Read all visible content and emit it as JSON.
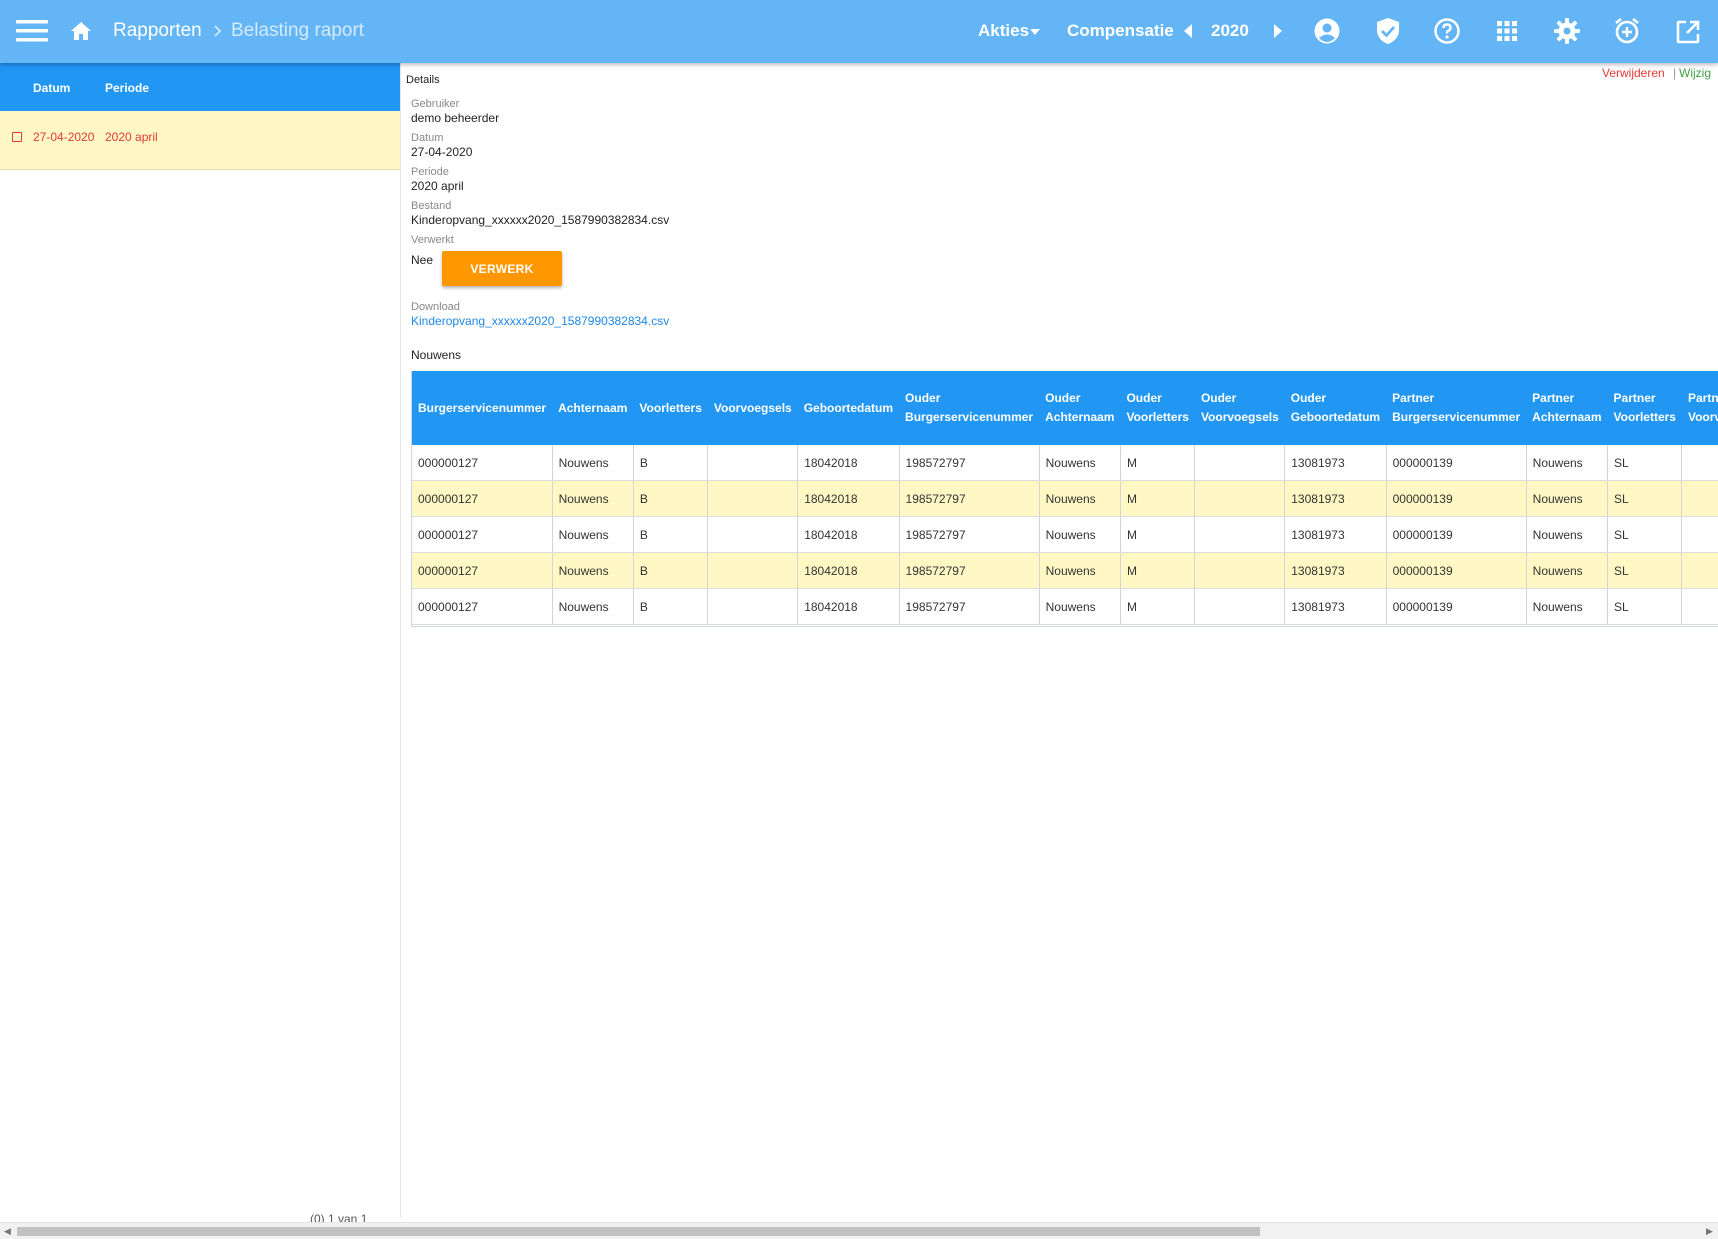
{
  "header": {
    "breadcrumb": [
      "Rapporten",
      "Belasting raport"
    ],
    "actions_label": "Akties",
    "compensation_label": "Compensatie",
    "year": "2020"
  },
  "left": {
    "columns": [
      "Datum",
      "Periode"
    ],
    "rows": [
      {
        "datum": "27-04-2020",
        "periode": "2020 april"
      }
    ]
  },
  "details": {
    "title": "Details",
    "delete_label": "Verwijderen",
    "separator": "|",
    "edit_label": "Wijzig",
    "gebruiker_label": "Gebruiker",
    "gebruiker": "demo beheerder",
    "datum_label": "Datum",
    "datum": "27-04-2020",
    "periode_label": "Periode",
    "periode": "2020 april",
    "bestand_label": "Bestand",
    "bestand": "Kinderopvang_xxxxxx2020_1587990382834.csv",
    "verwerkt_label": "Verwerkt",
    "verwerkt": "Nee",
    "verwerk_button": "VERWERK",
    "download_label": "Download",
    "download_link": "Kinderopvang_xxxxxx2020_1587990382834.csv",
    "group_name": "Nouwens"
  },
  "table": {
    "columns": [
      [
        "Burgerservicenummer"
      ],
      [
        "Achternaam"
      ],
      [
        "Voorletters"
      ],
      [
        "Voorvoegsels"
      ],
      [
        "Geboortedatum"
      ],
      [
        "Ouder",
        "Burgerservicenummer"
      ],
      [
        "Ouder",
        "Achternaam"
      ],
      [
        "Ouder",
        "Voorletters"
      ],
      [
        "Ouder",
        "Voorvoegsels"
      ],
      [
        "Ouder",
        "Geboortedatum"
      ],
      [
        "Partner",
        "Burgerservicenummer"
      ],
      [
        "Partner",
        "Achternaam"
      ],
      [
        "Partner",
        "Voorletters"
      ],
      [
        "Partner",
        "Voorvoegsels"
      ]
    ],
    "rows": [
      [
        "000000127",
        "Nouwens",
        "B",
        "",
        "18042018",
        "198572797",
        "Nouwens",
        "M",
        "",
        "13081973",
        "000000139",
        "Nouwens",
        "SL",
        ""
      ],
      [
        "000000127",
        "Nouwens",
        "B",
        "",
        "18042018",
        "198572797",
        "Nouwens",
        "M",
        "",
        "13081973",
        "000000139",
        "Nouwens",
        "SL",
        ""
      ],
      [
        "000000127",
        "Nouwens",
        "B",
        "",
        "18042018",
        "198572797",
        "Nouwens",
        "M",
        "",
        "13081973",
        "000000139",
        "Nouwens",
        "SL",
        ""
      ],
      [
        "000000127",
        "Nouwens",
        "B",
        "",
        "18042018",
        "198572797",
        "Nouwens",
        "M",
        "",
        "13081973",
        "000000139",
        "Nouwens",
        "SL",
        ""
      ],
      [
        "000000127",
        "Nouwens",
        "B",
        "",
        "18042018",
        "198572797",
        "Nouwens",
        "M",
        "",
        "13081973",
        "000000139",
        "Nouwens",
        "SL",
        ""
      ]
    ]
  },
  "pager_text": "(0)   1 van 1",
  "icons": {
    "menu": "hamburger-menu-icon",
    "home": "home-icon",
    "breadcrumb_separator": "chevron-right-icon",
    "actions_caret": "caret-down-icon",
    "prev_year": "caret-left-icon",
    "next_year": "caret-right-icon",
    "user": "account-circle-icon",
    "shield": "shield-check-icon",
    "help": "help-circle-icon",
    "apps": "apps-grid-icon",
    "settings": "gear-icon",
    "alarm": "alarm-plus-icon",
    "open_external": "open-in-new-icon",
    "row_checkbox": "checkbox-icon"
  },
  "colors": {
    "topbar": "#64b5f6",
    "header_blue": "#2196f3",
    "row_highlight": "#fff8c4",
    "accent_orange": "#ff9800",
    "delete_red": "#e53935",
    "edit_green": "#43a047",
    "link_blue": "#1e88e5"
  }
}
